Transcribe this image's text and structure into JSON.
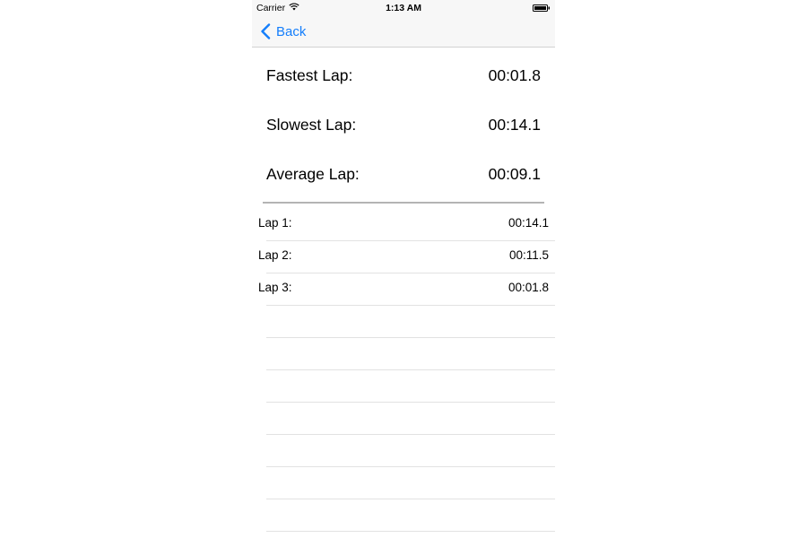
{
  "status_bar": {
    "carrier": "Carrier",
    "time": "1:13 AM",
    "wifi_icon": "wifi-icon",
    "battery_icon": "battery-icon"
  },
  "nav": {
    "back_label": "Back",
    "back_icon": "chevron-left-icon",
    "accent_color": "#147efb"
  },
  "stats": [
    {
      "label": "Fastest Lap:",
      "value": "00:01.8"
    },
    {
      "label": "Slowest Lap:",
      "value": "00:14.1"
    },
    {
      "label": "Average Lap:",
      "value": "00:09.1"
    }
  ],
  "laps": [
    {
      "label": "Lap 1:",
      "time": "00:14.1"
    },
    {
      "label": "Lap 2:",
      "time": "00:11.5"
    },
    {
      "label": "Lap 3:",
      "time": "00:01.8"
    }
  ]
}
